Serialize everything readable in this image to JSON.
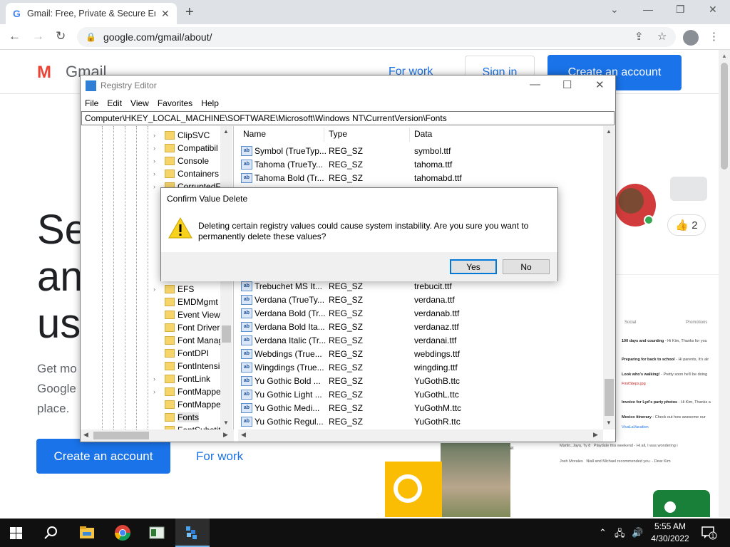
{
  "browser": {
    "tab_title": "Gmail: Free, Private & Secure Em",
    "url": "google.com/gmail/about/"
  },
  "gmail": {
    "wordmark": "Gmail",
    "for_work": "For work",
    "sign_in": "Sign in",
    "create_account": "Create an account",
    "hero_lines": [
      "Se",
      "an",
      "us"
    ],
    "sub_lines": [
      "Get mo",
      "Google",
      "place."
    ],
    "create_account_2": "Create an account",
    "for_work_2": "For work",
    "like_count": "👍 2",
    "inbox_tabs": [
      "Social",
      "Promotions"
    ],
    "inbox_rows": [
      {
        "subject": "100 days and counting",
        "snippet": " - Hi Kim, Thanks for you"
      },
      {
        "subject": "Preparing for back to school",
        "snippet": " - Hi parents, It's alr"
      },
      {
        "subject": "Look who's walking!",
        "snippet": " - Pretty soon he'll be doing"
      },
      {
        "subject": "FirstSteps.jpg",
        "snippet": ""
      },
      {
        "subject": "Invoice for Lyd's party photos",
        "snippet": " - Hi Kim, Thanks a"
      },
      {
        "subject": "Mexico itinerary",
        "snippet": " - Check out how awesome our"
      },
      {
        "subject": "VivaLaVacation",
        "snippet": ""
      }
    ],
    "meet_label": "Meet",
    "lower_rows": [
      {
        "from": "Martin, Jaya, Ty 8",
        "text": "Playdate this weekend - Hi all, I was wondering i"
      },
      {
        "from": "Josh Morales",
        "text": "Niall and Michael recommended you. - Dear Kim"
      }
    ]
  },
  "regedit": {
    "title": "Registry Editor",
    "menu": [
      "File",
      "Edit",
      "View",
      "Favorites",
      "Help"
    ],
    "address": "Computer\\HKEY_LOCAL_MACHINE\\SOFTWARE\\Microsoft\\Windows NT\\CurrentVersion\\Fonts",
    "tree": [
      {
        "label": "ClipSVC",
        "expander": true
      },
      {
        "label": "Compatibil",
        "expander": true
      },
      {
        "label": "Console",
        "expander": true
      },
      {
        "label": "Containers",
        "expander": true
      },
      {
        "label": "CorruptedF",
        "expander": true
      },
      {
        "label": "EFS",
        "expander": true
      },
      {
        "label": "EMDMgmt",
        "expander": false
      },
      {
        "label": "Event Viewe",
        "expander": false
      },
      {
        "label": "Font Driver",
        "expander": false
      },
      {
        "label": "Font Manag",
        "expander": false
      },
      {
        "label": "FontDPI",
        "expander": false
      },
      {
        "label": "FontIntensi",
        "expander": false
      },
      {
        "label": "FontLink",
        "expander": true
      },
      {
        "label": "FontMappe",
        "expander": true
      },
      {
        "label": "FontMappe",
        "expander": false
      },
      {
        "label": "Fonts",
        "expander": false,
        "selected": true
      },
      {
        "label": "FontSubstit",
        "expander": false
      }
    ],
    "columns": [
      "Name",
      "Type",
      "Data"
    ],
    "values": [
      {
        "name": "Symbol (TrueTyp...",
        "type": "REG_SZ",
        "data": "symbol.ttf"
      },
      {
        "name": "Tahoma (TrueTy...",
        "type": "REG_SZ",
        "data": "tahoma.ttf"
      },
      {
        "name": "Tahoma Bold (Tr...",
        "type": "REG_SZ",
        "data": "tahomabd.ttf"
      },
      {
        "name": "Trebuchet MS It...",
        "type": "REG_SZ",
        "data": "trebucit.ttf"
      },
      {
        "name": "Verdana (TrueTy...",
        "type": "REG_SZ",
        "data": "verdana.ttf"
      },
      {
        "name": "Verdana Bold (Tr...",
        "type": "REG_SZ",
        "data": "verdanab.ttf"
      },
      {
        "name": "Verdana Bold Ita...",
        "type": "REG_SZ",
        "data": "verdanaz.ttf"
      },
      {
        "name": "Verdana Italic (Tr...",
        "type": "REG_SZ",
        "data": "verdanai.ttf"
      },
      {
        "name": "Webdings (True...",
        "type": "REG_SZ",
        "data": "webdings.ttf"
      },
      {
        "name": "Wingdings (True...",
        "type": "REG_SZ",
        "data": "wingding.ttf"
      },
      {
        "name": "Yu Gothic Bold ...",
        "type": "REG_SZ",
        "data": "YuGothB.ttc"
      },
      {
        "name": "Yu Gothic Light ...",
        "type": "REG_SZ",
        "data": "YuGothL.ttc"
      },
      {
        "name": "Yu Gothic Medi...",
        "type": "REG_SZ",
        "data": "YuGothM.ttc"
      },
      {
        "name": "Yu Gothic Regul...",
        "type": "REG_SZ",
        "data": "YuGothR.ttc"
      }
    ],
    "value_icon_text": "ab"
  },
  "dialog": {
    "title": "Confirm Value Delete",
    "message": "Deleting certain registry values could cause system instability. Are you sure you want to permanently delete these values?",
    "yes": "Yes",
    "no": "No"
  },
  "taskbar": {
    "time": "5:55 AM",
    "date": "4/30/2022",
    "notification_count": "1"
  },
  "colors": {
    "gmail_blue": "#1a73e8",
    "taskbar_bg": "#101010",
    "dialog_default_border": "#0078d7"
  }
}
